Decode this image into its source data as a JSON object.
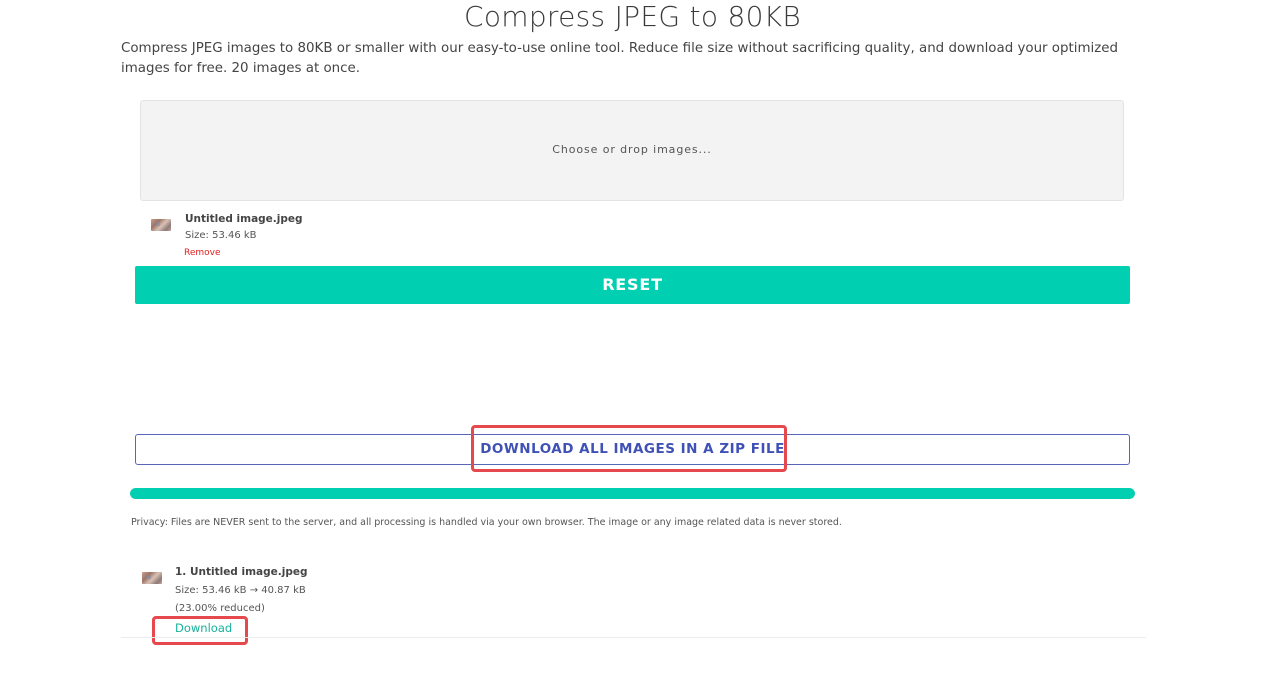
{
  "header": {
    "title": "Compress JPEG to 80KB",
    "description": "Compress JPEG images to 80KB or smaller with our easy-to-use online tool. Reduce file size without sacrificing quality, and download your optimized images for free. 20 images at once."
  },
  "dropzone": {
    "text": "Choose or drop images..."
  },
  "uploaded_file": {
    "thumbnail_icon": "image-thumbnail",
    "name": "Untitled image.jpeg",
    "size": "Size: 53.46 kB",
    "remove_label": "Remove"
  },
  "actions": {
    "reset_label": "RESET",
    "zip_label": "DOWNLOAD ALL IMAGES IN A ZIP FILE"
  },
  "progress": {
    "percent": 100
  },
  "privacy": {
    "text": "Privacy: Files are NEVER sent to the server, and all processing is handled via your own browser. The image or any image related data is never stored."
  },
  "results": [
    {
      "thumbnail_icon": "image-thumbnail",
      "name": "1. Untitled image.jpeg",
      "size": "Size: 53.46 kB  →  40.87 kB",
      "reduced": "(23.00% reduced)",
      "download_label": "Download"
    }
  ],
  "colors": {
    "accent": "#00cfb1",
    "zip_button": "#3f51b5",
    "remove": "#e02020",
    "highlight": "#e5484d"
  }
}
